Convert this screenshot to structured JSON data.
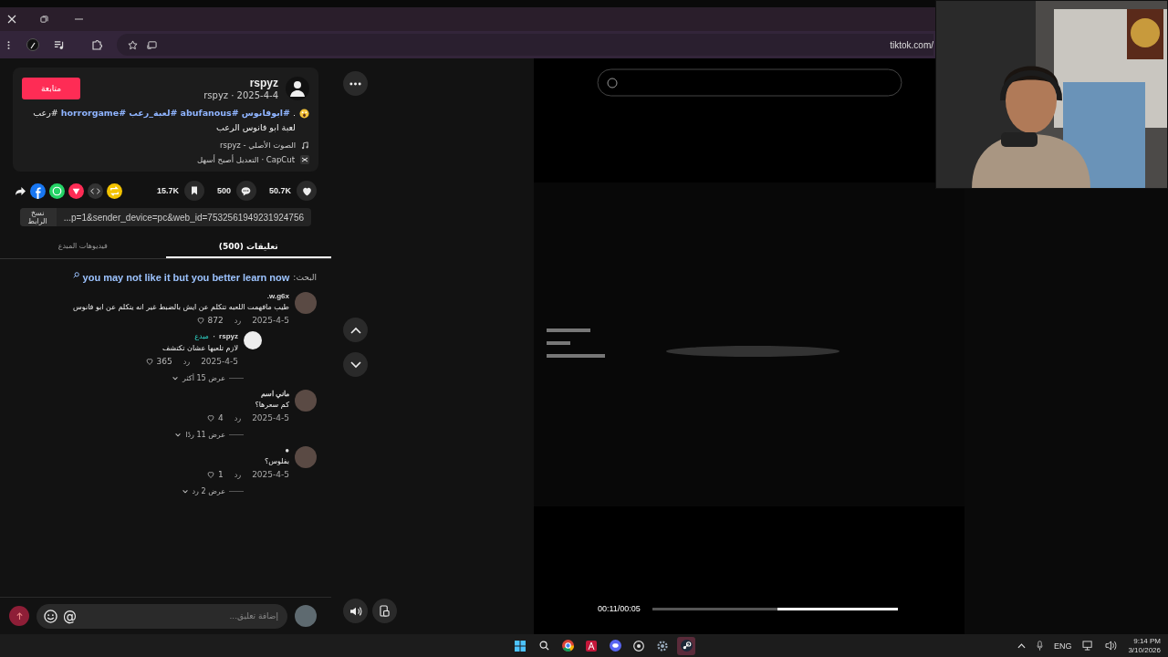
{
  "browser": {
    "address": "tiktok.com/"
  },
  "post": {
    "follow_button": "متابعة",
    "author": "rspyz",
    "meta": "2025-4-4 · rspyz",
    "caption": [
      {
        "kind": "plain",
        "text": "."
      },
      {
        "kind": "hashtag",
        "text": "#ابوفانوس"
      },
      {
        "kind": "hashtag",
        "text": "#abufanous"
      },
      {
        "kind": "hashtag",
        "text": "#لعبة_رعب"
      },
      {
        "kind": "hashtag",
        "text": "#horrorgame"
      },
      {
        "kind": "plain",
        "text": "#رعب لعبة ابو فانوس الرعب"
      }
    ],
    "sound": "الصوت الأصلي - rspyz",
    "editor": "CapCut · التعديل أصبح أسهل"
  },
  "stats": [
    {
      "kind": "like",
      "count": "50.7K"
    },
    {
      "kind": "comment",
      "count": "500"
    },
    {
      "kind": "bookmark",
      "count": "15.7K"
    }
  ],
  "link": {
    "url": "...p=1&sender_device=pc&web_id=7532561949231924756",
    "copy_button": "نسخ الرابط"
  },
  "tabs": [
    {
      "label": "تعليقات (500)",
      "selected": true
    },
    {
      "label": "فيديوهات المبدع",
      "selected": false
    }
  ],
  "search_hint": {
    "label": "البحث:",
    "query": "you may not like it but you better learn now"
  },
  "comments": [
    {
      "user": "w.g6x.",
      "text": "طيب مافهمت اللعبه تتكلم عن ايش بالضبط غير انه يتكلم عن ابو فانوس",
      "date": "2025-4-5",
      "reply": "رد",
      "likes": "872",
      "replies": [
        {
          "user": "rspyz",
          "separator": "·",
          "badge": "مبدع",
          "text": "لازم تلعبها عشان تكتشف",
          "date": "2025-4-5",
          "reply": "رد",
          "likes": "365"
        }
      ],
      "more": "عرض 15 أكثر"
    },
    {
      "user": "ماني اسم",
      "text": "كم سعرها؟",
      "date": "2025-4-5",
      "reply": "رد",
      "likes": "4",
      "more": "عرض 11 ردًا"
    },
    {
      "user": "●",
      "text": "بفلوس؟",
      "date": "2025-4-5",
      "reply": "رد",
      "likes": "1",
      "more": "عرض 2 رد"
    }
  ],
  "composer": {
    "placeholder": "إضافة تعليق...",
    "mention": "@"
  },
  "player": {
    "time": "00:11/00:05",
    "level": 0.49
  },
  "taskbar": {
    "language": "ENG",
    "time": "9:14 PM",
    "date": "3/10/2026"
  }
}
